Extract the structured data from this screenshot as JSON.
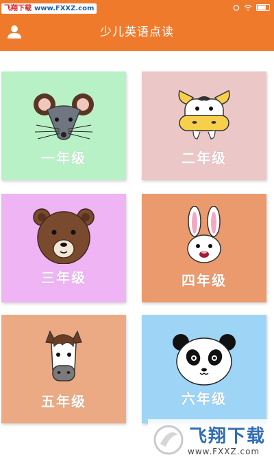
{
  "statusbar": {
    "watermark_top_part1": "飞翔下载",
    "watermark_top_part2": "www.FXXZ.com"
  },
  "header": {
    "title": "少儿英语点读",
    "profile_icon": "user-icon"
  },
  "grades": [
    {
      "label": "一年级",
      "animal": "mouse",
      "bg": "#b9f1c7"
    },
    {
      "label": "二年级",
      "animal": "cow",
      "bg": "#ecc7c7"
    },
    {
      "label": "三年级",
      "animal": "bear",
      "bg": "#eeb4f4"
    },
    {
      "label": "四年级",
      "animal": "rabbit",
      "bg": "#eb9a6d"
    },
    {
      "label": "五年级",
      "animal": "horse",
      "bg": "#ebaa83"
    },
    {
      "label": "六年级",
      "animal": "panda",
      "bg": "#9ed4f5"
    }
  ],
  "watermark_bottom": {
    "brand": "飞翔下载",
    "url": "www.FXXZ.com"
  },
  "colors": {
    "accent": "#f07a2c"
  }
}
